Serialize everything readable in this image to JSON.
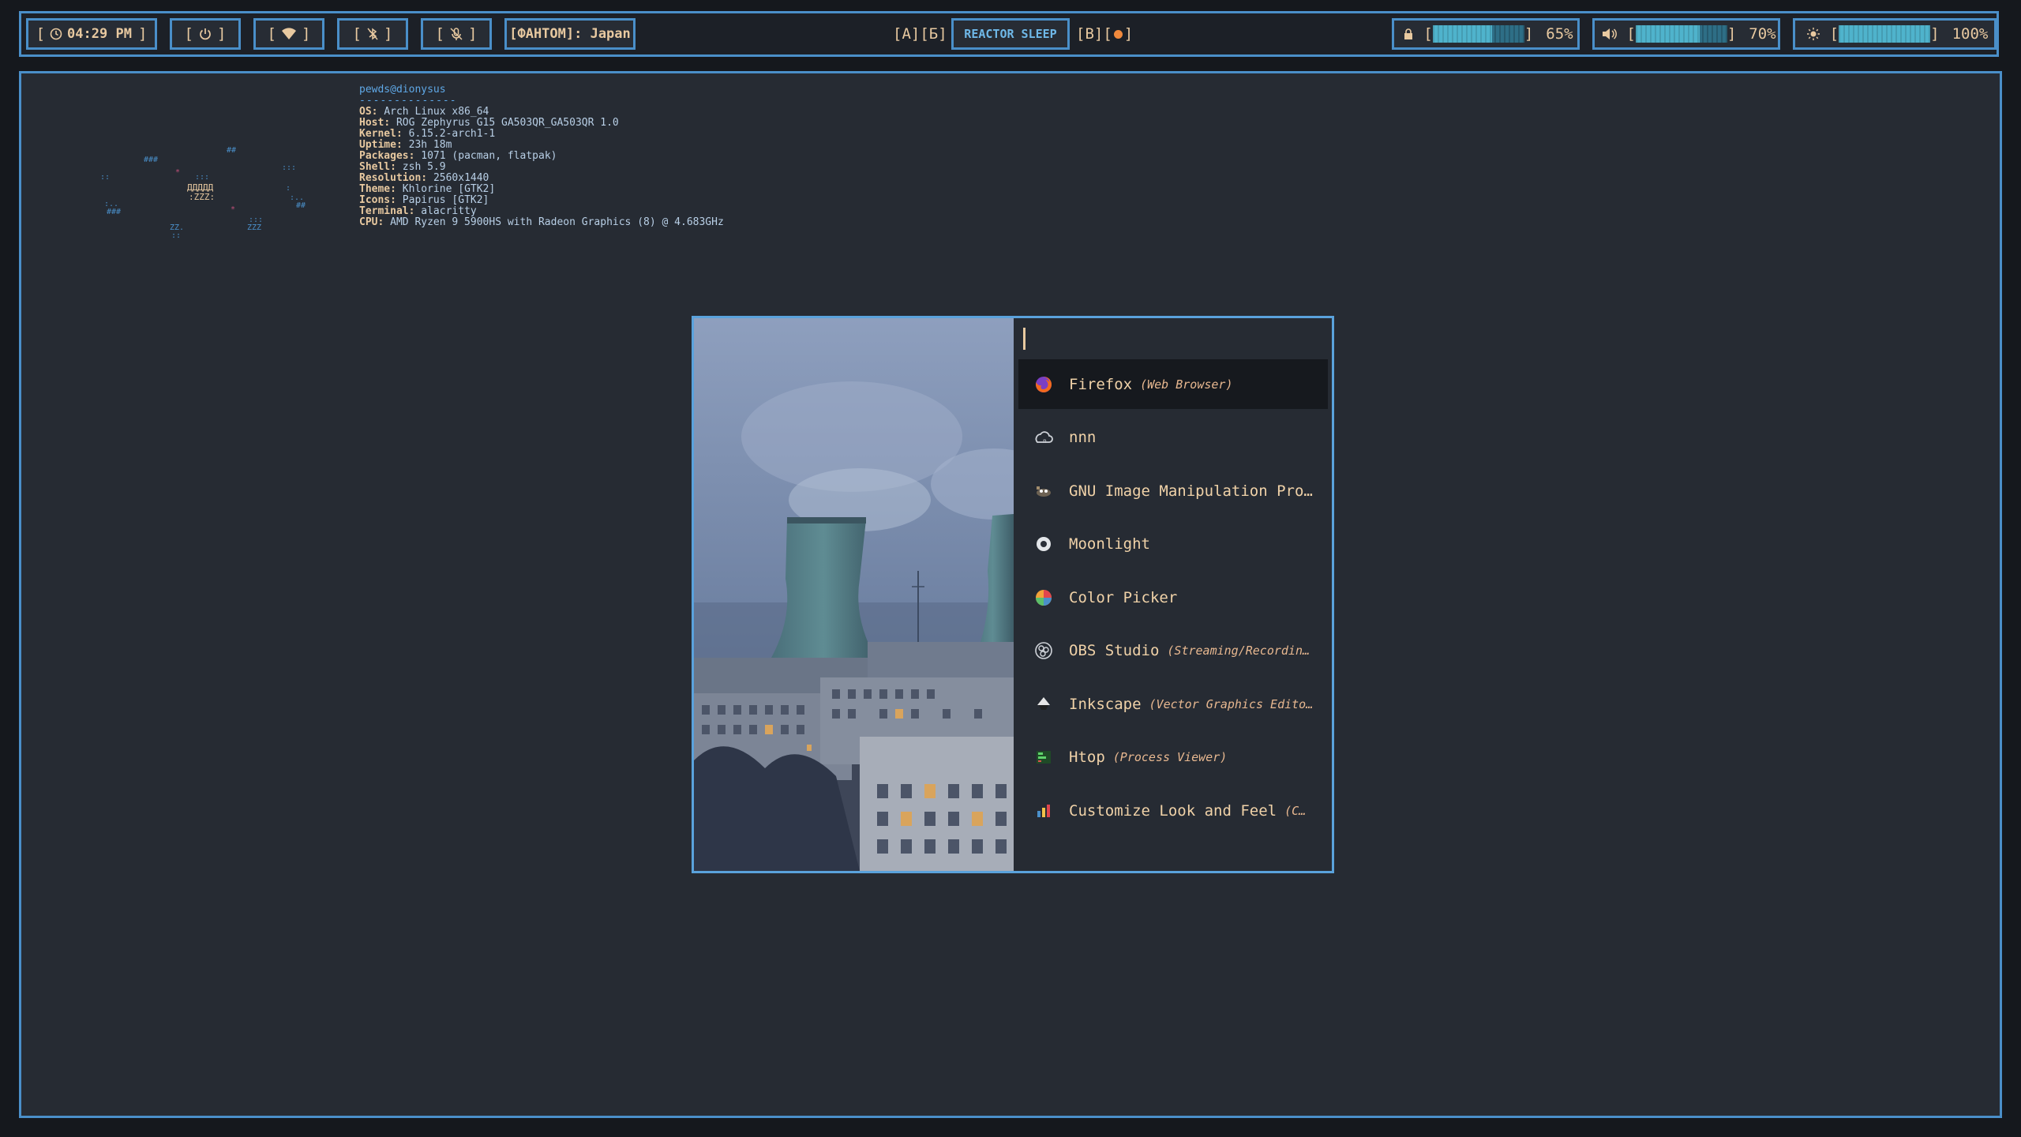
{
  "topbar": {
    "clock": "04:29 PM",
    "vpn_label": "[ФAHTOM]: Japan",
    "workspace_left": "[A][Б]",
    "workspace_active": "REACTOR SLEEP",
    "workspace_right_prefix": "[B][",
    "workspace_right_suffix": "]",
    "battery": {
      "percent_label": "65%",
      "level": 0.65
    },
    "volume": {
      "percent_label": "70%",
      "level": 0.7
    },
    "brightness": {
      "percent_label": "100%",
      "level": 1.0
    },
    "bracket_open": "[",
    "bracket_close": "]",
    "icons": {
      "clock": "clock-icon",
      "power": "power-icon",
      "wifi": "wifi-icon",
      "bluetooth": "bluetooth-off-icon",
      "mic": "mic-muted-icon",
      "battery": "lock-battery-icon",
      "volume": "speaker-icon",
      "brightness": "sun-icon"
    },
    "colors": {
      "accent": "#4a8fc9",
      "text": "#e8c9a0",
      "meter": "#4fb3cc",
      "dot": "#f0893c"
    }
  },
  "fetch": {
    "user_host": "pewds@dionysus",
    "separator": "--------------",
    "rows": [
      {
        "key": "OS",
        "value": "Arch Linux x86_64"
      },
      {
        "key": "Host",
        "value": "ROG Zephyrus G15 GA503QR_GA503QR 1.0"
      },
      {
        "key": "Kernel",
        "value": "6.15.2-arch1-1"
      },
      {
        "key": "Uptime",
        "value": "23h 18m"
      },
      {
        "key": "Packages",
        "value": "1071 (pacman, flatpak)"
      },
      {
        "key": "Shell",
        "value": "zsh 5.9"
      },
      {
        "key": "Resolution",
        "value": "2560x1440"
      },
      {
        "key": "Theme",
        "value": "Khlorine [GTK2]"
      },
      {
        "key": "Icons",
        "value": "Papirus [GTK2]"
      },
      {
        "key": "Terminal",
        "value": "alacritty"
      },
      {
        "key": "CPU",
        "value": "AMD Ryzen 9 5900HS with Radeon Graphics (8) @ 4.683GHz"
      }
    ]
  },
  "launcher": {
    "search_value": "",
    "entries": [
      {
        "name": "Firefox",
        "desc": "(Web Browser)",
        "icon": "firefox-icon",
        "selected": true
      },
      {
        "name": "nnn",
        "desc": "",
        "icon": "nnn-icon",
        "selected": false
      },
      {
        "name": "GNU Image Manipulation Pro…",
        "desc": "",
        "icon": "gimp-icon",
        "selected": false
      },
      {
        "name": "Moonlight",
        "desc": "",
        "icon": "moonlight-icon",
        "selected": false
      },
      {
        "name": "Color Picker",
        "desc": "",
        "icon": "color-picker-icon",
        "selected": false
      },
      {
        "name": "OBS Studio",
        "desc": "(Streaming/Recordin…",
        "icon": "obs-icon",
        "selected": false
      },
      {
        "name": "Inkscape",
        "desc": "(Vector Graphics Edito…",
        "icon": "inkscape-icon",
        "selected": false
      },
      {
        "name": "Htop",
        "desc": "(Process Viewer)",
        "icon": "htop-icon",
        "selected": false
      },
      {
        "name": "Customize Look and Feel",
        "desc": "(C…",
        "icon": "customize-icon",
        "selected": false
      }
    ]
  }
}
